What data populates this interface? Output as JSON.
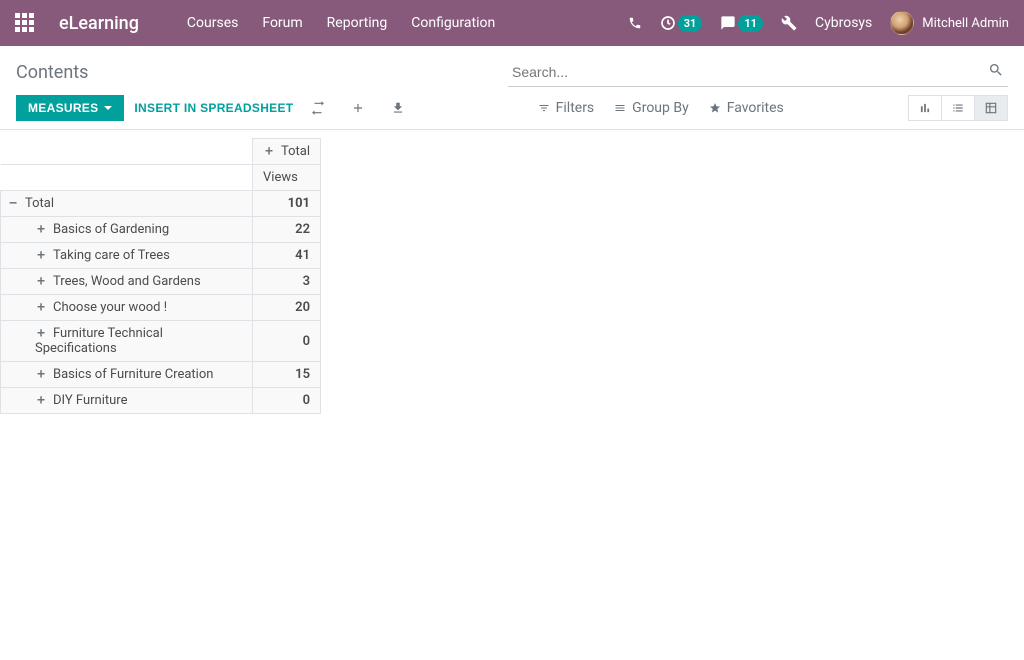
{
  "navbar": {
    "brand": "eLearning",
    "menu": {
      "courses": "Courses",
      "forum": "Forum",
      "reporting": "Reporting",
      "configuration": "Configuration"
    },
    "badges": {
      "activities": "31",
      "messages": "11"
    },
    "company": "Cybrosys",
    "user": "Mitchell Admin"
  },
  "breadcrumb": "Contents",
  "search": {
    "placeholder": "Search..."
  },
  "toolbar": {
    "measures": "MEASURES",
    "insert_spreadsheet": "INSERT IN SPREADSHEET",
    "filters": "Filters",
    "group_by": "Group By",
    "favorites": "Favorites"
  },
  "pivot": {
    "col_total_label": "Total",
    "measure_label": "Views",
    "row_total_label": "Total",
    "total_value": "101",
    "rows": [
      {
        "label": "Basics of Gardening",
        "value": "22"
      },
      {
        "label": "Taking care of Trees",
        "value": "41"
      },
      {
        "label": "Trees, Wood and Gardens",
        "value": "3"
      },
      {
        "label": "Choose your wood !",
        "value": "20"
      },
      {
        "label": "Furniture Technical Specifications",
        "value": "0"
      },
      {
        "label": "Basics of Furniture Creation",
        "value": "15"
      },
      {
        "label": "DIY Furniture",
        "value": "0"
      }
    ]
  }
}
